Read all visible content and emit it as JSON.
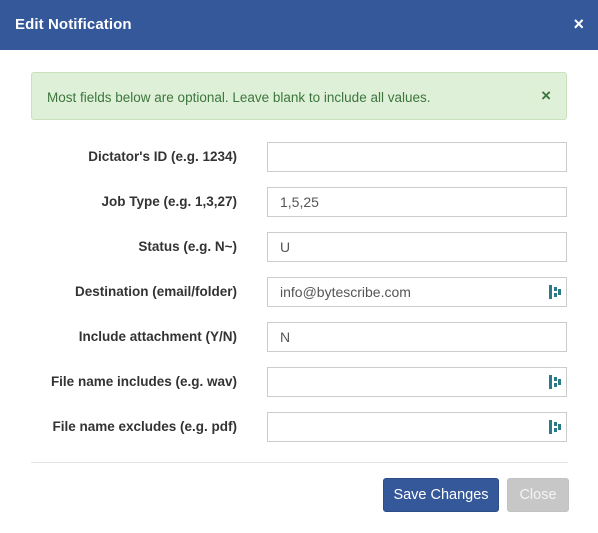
{
  "modal": {
    "title": "Edit Notification",
    "close_symbol": "×"
  },
  "alert": {
    "message": "Most fields below are optional. Leave blank to include all values.",
    "close_symbol": "×"
  },
  "fields": {
    "dictator_id": {
      "label": "Dictator's ID (e.g. 1234)",
      "value": ""
    },
    "job_type": {
      "label": "Job Type (e.g. 1,3,27)",
      "value": "1,5,25"
    },
    "status": {
      "label": "Status (e.g. N~)",
      "value": "U"
    },
    "destination": {
      "label": "Destination (email/folder)",
      "value": "info@bytescribe.com",
      "icon": "field-helper-icon"
    },
    "include_attachment": {
      "label": "Include attachment (Y/N)",
      "value": "N"
    },
    "file_name_includes": {
      "label": "File name includes (e.g. wav)",
      "value": "",
      "icon": "field-helper-icon"
    },
    "file_name_excludes": {
      "label": "File name excludes (e.g. pdf)",
      "value": "",
      "icon": "field-helper-icon"
    }
  },
  "footer": {
    "save_label": "Save Changes",
    "close_label": "Close"
  },
  "colors": {
    "header": "#34589a",
    "alert_bg": "#dff0d8",
    "alert_text": "#3c763d",
    "primary_button": "#34589a",
    "disabled_button": "#c7c7c7",
    "helper_icon": "#2a7a8c"
  }
}
